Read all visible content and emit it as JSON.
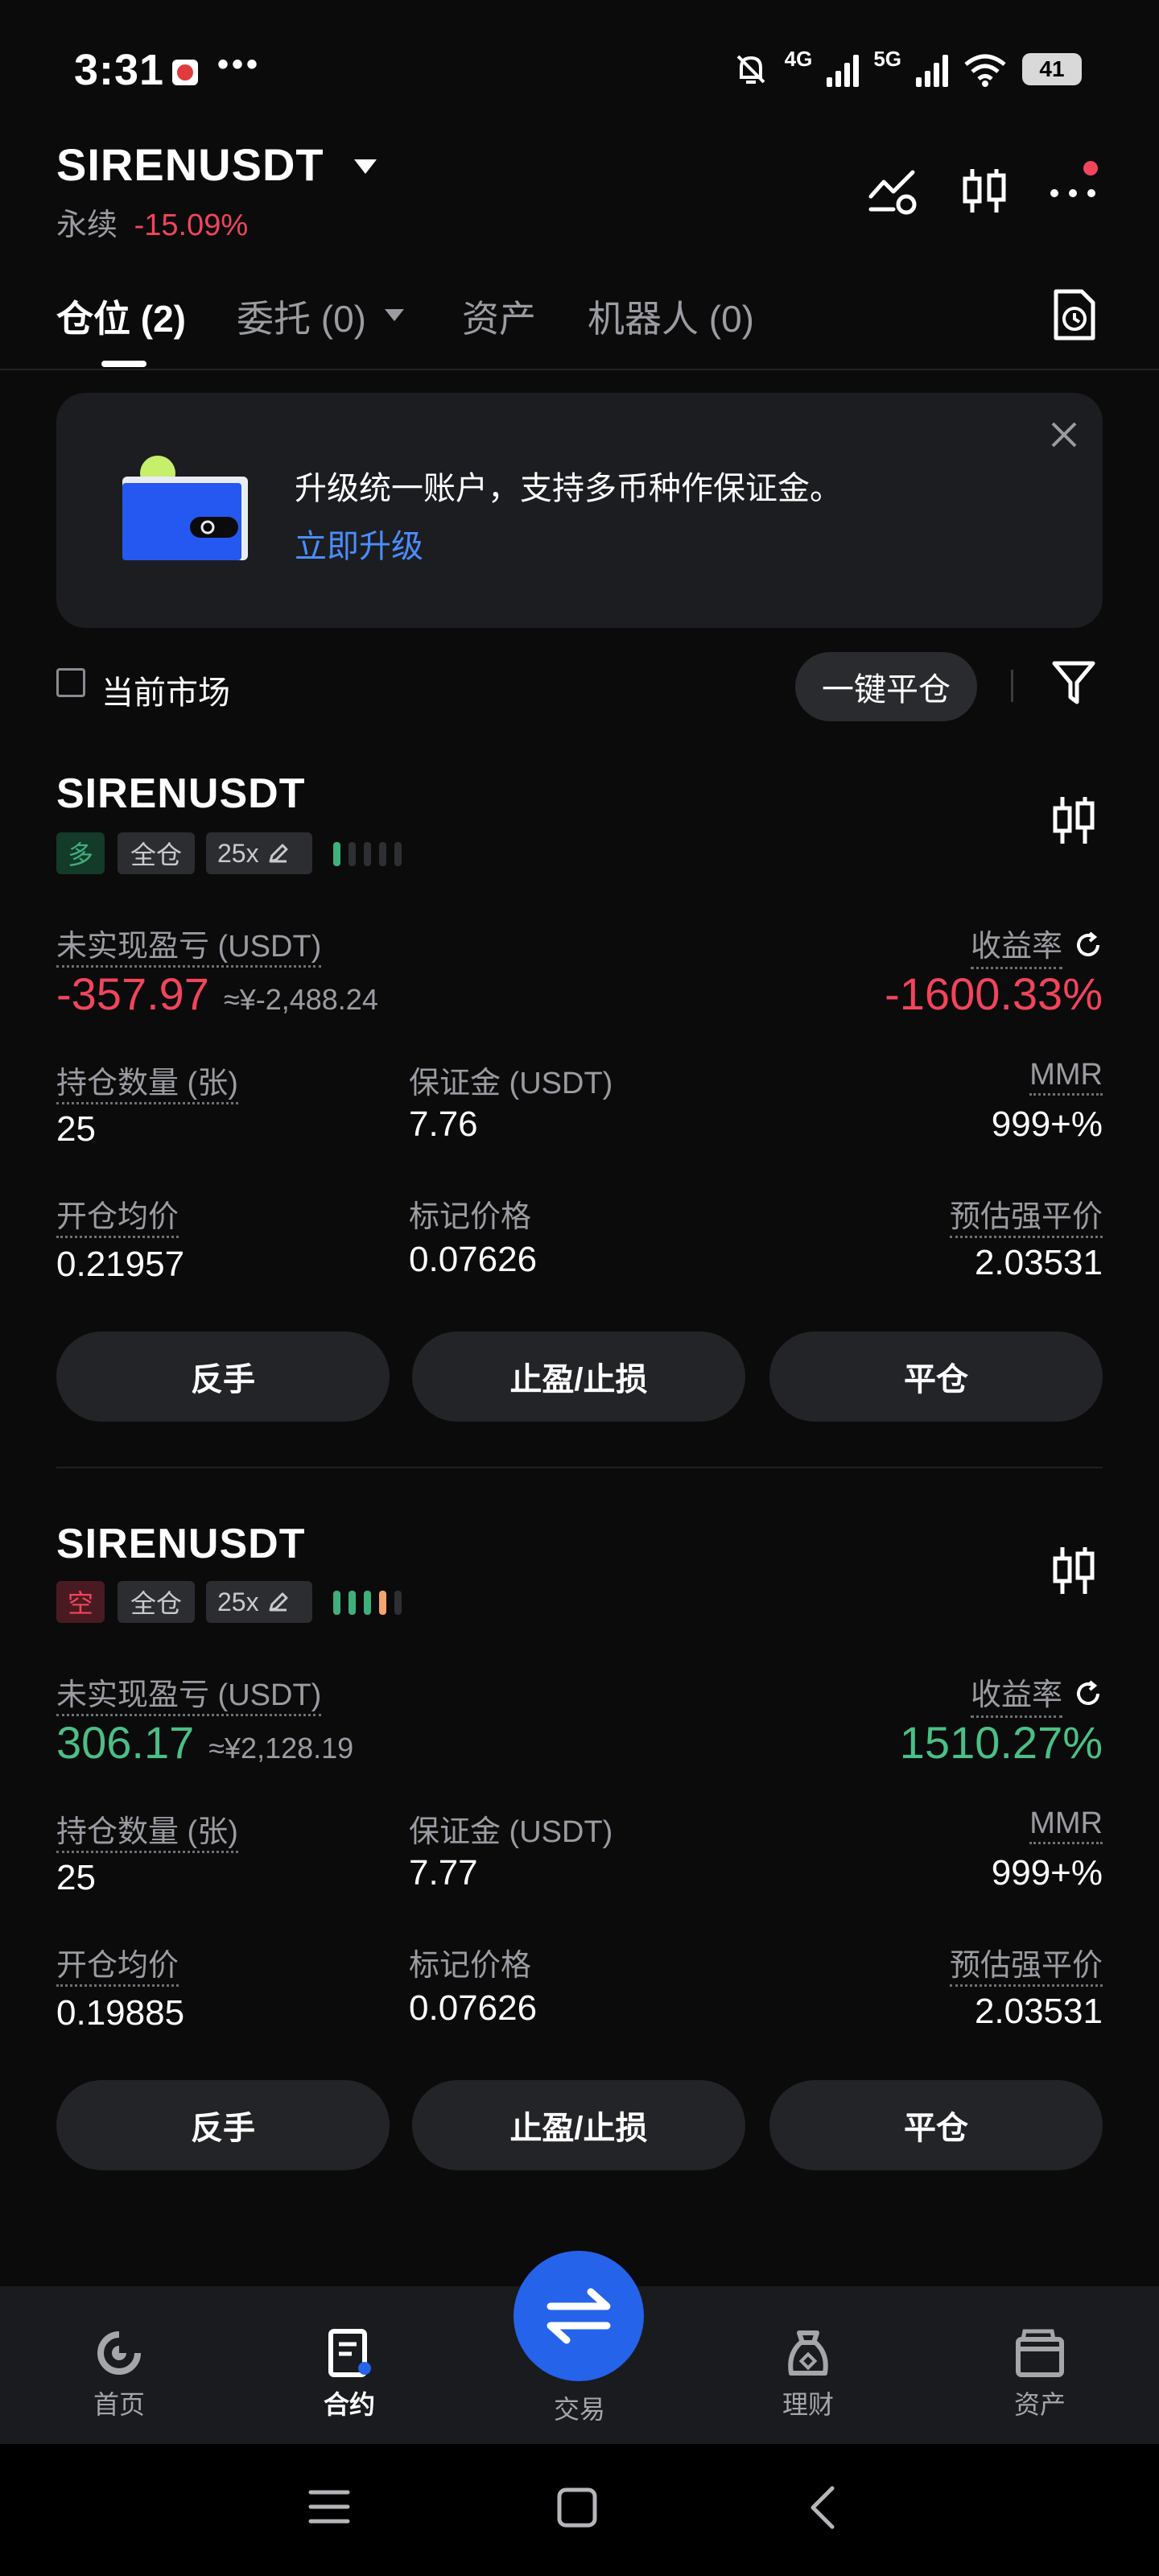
{
  "status_bar": {
    "time": "3:31",
    "dots": "•••",
    "net1": "4G",
    "net2": "5G",
    "battery": "41"
  },
  "header": {
    "pair": "SIRENUSDT",
    "contract_type": "永续",
    "change": "-15.09%"
  },
  "tabs": [
    {
      "label": "仓位 (2)"
    },
    {
      "label": "委托 (0)"
    },
    {
      "label": "资产"
    },
    {
      "label": "机器人 (0)"
    }
  ],
  "banner": {
    "text": "升级统一账户，支持多币种作保证金。",
    "link": "立即升级"
  },
  "filter": {
    "current_market": "当前市场",
    "close_all": "一键平仓"
  },
  "labels": {
    "unrealized_pnl": "未实现盈亏 (USDT)",
    "roe": "收益率",
    "position_size": "持仓数量 (张)",
    "margin": "保证金 (USDT)",
    "mmr": "MMR",
    "entry_price": "开仓均价",
    "mark_price": "标记价格",
    "liq_price": "预估强平价",
    "reverse": "反手",
    "tp_sl": "止盈/止损",
    "close": "平仓"
  },
  "positions": [
    {
      "symbol": "SIRENUSDT",
      "side": "多",
      "margin_mode": "全仓",
      "leverage": "25x",
      "pnl": "-357.97",
      "pnl_cny": "≈¥-2,488.24",
      "roe": "-1600.33%",
      "size": "25",
      "margin": "7.76",
      "mmr": "999+%",
      "entry": "0.21957",
      "mark": "0.07626",
      "liq": "2.03531",
      "risk_level": 1
    },
    {
      "symbol": "SIRENUSDT",
      "side": "空",
      "margin_mode": "全仓",
      "leverage": "25x",
      "pnl": "306.17",
      "pnl_cny": "≈¥2,128.19",
      "roe": "1510.27%",
      "size": "25",
      "margin": "7.77",
      "mmr": "999+%",
      "entry": "0.19885",
      "mark": "0.07626",
      "liq": "2.03531",
      "risk_level": 4
    }
  ],
  "bottom_nav": [
    {
      "label": "首页",
      "icon": "home-icon"
    },
    {
      "label": "合约",
      "icon": "contract-icon"
    },
    {
      "label": "交易",
      "icon": "swap-icon"
    },
    {
      "label": "理财",
      "icon": "finance-icon"
    },
    {
      "label": "资产",
      "icon": "wallet-icon"
    }
  ],
  "colors": {
    "negative": "#f0455b",
    "positive": "#4bbf85",
    "accent": "#2563eb",
    "link": "#4b8dff",
    "liq": "#f2a56e"
  }
}
